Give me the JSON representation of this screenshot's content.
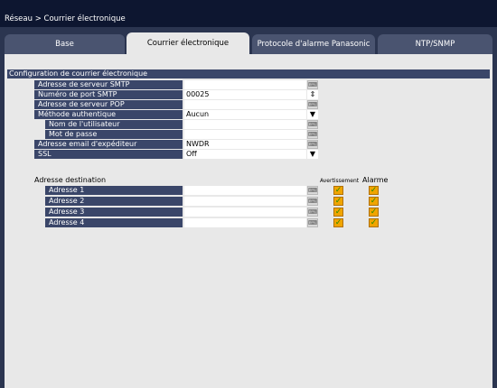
{
  "breadcrumb": "Réseau > Courrier électronique",
  "tabs": [
    {
      "label": "Base",
      "active": false
    },
    {
      "label": "Courrier électronique",
      "active": true
    },
    {
      "label": "Protocole d'alarme Panasonic",
      "active": false
    },
    {
      "label": "NTP/SNMP",
      "active": false
    }
  ],
  "section_title": "Configuration de courrier électronique",
  "fields": {
    "smtp": {
      "label": "Adresse de serveur SMTP",
      "value": ""
    },
    "smtp_port": {
      "label": "Numéro de port SMTP",
      "value": "00025"
    },
    "pop": {
      "label": "Adresse de serveur POP",
      "value": ""
    },
    "auth": {
      "label": "Méthode authentique",
      "value": "Aucun"
    },
    "user": {
      "label": "Nom de l'utilisateur",
      "value": ""
    },
    "pass": {
      "label": "Mot de passe",
      "value": ""
    },
    "sender": {
      "label": "Adresse email d'expéditeur",
      "value": "NWDR"
    },
    "ssl": {
      "label": "SSL",
      "value": "Off"
    }
  },
  "destination": {
    "label": "Adresse destination",
    "col_warning": "Avertissement",
    "col_alarm": "Alarme",
    "rows": [
      {
        "label": "Adresse 1",
        "value": "",
        "warning": true,
        "alarm": true
      },
      {
        "label": "Adresse 2",
        "value": "",
        "warning": true,
        "alarm": true
      },
      {
        "label": "Adresse 3",
        "value": "",
        "warning": true,
        "alarm": true
      },
      {
        "label": "Adresse 4",
        "value": "",
        "warning": true,
        "alarm": true
      }
    ]
  },
  "icons": {
    "keyboard": "keyboard-icon",
    "spinner": "spinner-icon",
    "dropdown": "chevron-down-icon",
    "check": "check-icon"
  },
  "colors": {
    "label_bg": "#3a4669",
    "panel_bg": "#e8e8e8",
    "checkbox": "#f0a500"
  }
}
